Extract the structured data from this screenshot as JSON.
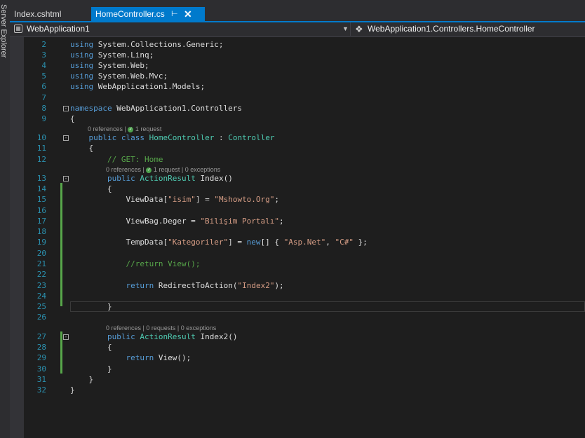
{
  "side_panel": {
    "label": "Server Explorer"
  },
  "tabs": [
    {
      "label": "Index.cshtml",
      "active": false
    },
    {
      "label": "HomeController.cs",
      "active": true
    }
  ],
  "icons": {
    "pin": "pin-icon",
    "close": "close-icon",
    "project": "csharp-project-icon",
    "class": "class-icon",
    "dropdown": "chevron-down-icon"
  },
  "navigation": {
    "project": "WebApplication1",
    "type": "WebApplication1.Controllers.HomeController"
  },
  "codelens": {
    "class": {
      "refs": "0 references",
      "requests": "1 request"
    },
    "index": {
      "refs": "0 references",
      "requests": "1 request",
      "exceptions": "0 exceptions"
    },
    "index2": {
      "refs": "0 references",
      "requests": "0 requests",
      "exceptions": "0 exceptions"
    }
  },
  "colors": {
    "accent": "#007acc",
    "keyword": "#569cd6",
    "type": "#4ec9b0",
    "string": "#d69d85",
    "comment": "#57a64a",
    "line_number": "#2b91af"
  },
  "lines": [
    {
      "n": "2",
      "segs": [
        [
          "using",
          "kw"
        ],
        [
          " System.Collections.Generic;",
          ""
        ]
      ]
    },
    {
      "n": "3",
      "segs": [
        [
          "using",
          "kw"
        ],
        [
          " System.Linq;",
          ""
        ]
      ]
    },
    {
      "n": "4",
      "segs": [
        [
          "using",
          "kw"
        ],
        [
          " System.Web;",
          ""
        ]
      ]
    },
    {
      "n": "5",
      "segs": [
        [
          "using",
          "kw"
        ],
        [
          " System.Web.Mvc;",
          ""
        ]
      ]
    },
    {
      "n": "6",
      "segs": [
        [
          "using",
          "kw"
        ],
        [
          " WebApplication1.Models;",
          ""
        ]
      ]
    },
    {
      "n": "7",
      "segs": []
    },
    {
      "n": "8",
      "segs": [
        [
          "namespace",
          "kw"
        ],
        [
          " WebApplication1.Controllers",
          ""
        ]
      ]
    },
    {
      "n": "9",
      "segs": [
        [
          "{",
          ""
        ]
      ]
    },
    {
      "n": "10",
      "segs": [
        [
          "    ",
          ""
        ],
        [
          "public",
          "kw"
        ],
        [
          " ",
          ""
        ],
        [
          "class",
          "kw"
        ],
        [
          " ",
          ""
        ],
        [
          "HomeController",
          "ty"
        ],
        [
          " : ",
          ""
        ],
        [
          "Controller",
          "ty"
        ]
      ]
    },
    {
      "n": "11",
      "segs": [
        [
          "    {",
          ""
        ]
      ]
    },
    {
      "n": "12",
      "segs": [
        [
          "        ",
          ""
        ],
        [
          "// GET: Home",
          "cm"
        ]
      ]
    },
    {
      "n": "13",
      "segs": [
        [
          "        ",
          ""
        ],
        [
          "public",
          "kw"
        ],
        [
          " ",
          ""
        ],
        [
          "ActionResult",
          "ty"
        ],
        [
          " Index()",
          ""
        ]
      ]
    },
    {
      "n": "14",
      "segs": [
        [
          "        {",
          ""
        ]
      ]
    },
    {
      "n": "15",
      "segs": [
        [
          "            ViewData[",
          ""
        ],
        [
          "\"isim\"",
          "st"
        ],
        [
          "] = ",
          ""
        ],
        [
          "\"Mshowto.Org\"",
          "st"
        ],
        [
          ";",
          ""
        ]
      ]
    },
    {
      "n": "16",
      "segs": []
    },
    {
      "n": "17",
      "segs": [
        [
          "            ViewBag.Deger = ",
          ""
        ],
        [
          "\"Bilişim Portalı\"",
          "st"
        ],
        [
          ";",
          ""
        ]
      ]
    },
    {
      "n": "18",
      "segs": []
    },
    {
      "n": "19",
      "segs": [
        [
          "            TempData[",
          ""
        ],
        [
          "\"Kategoriler\"",
          "st"
        ],
        [
          "] = ",
          ""
        ],
        [
          "new",
          "kw"
        ],
        [
          "[] { ",
          ""
        ],
        [
          "\"Asp.Net\"",
          "st"
        ],
        [
          ", ",
          ""
        ],
        [
          "\"C#\"",
          "st"
        ],
        [
          " };",
          ""
        ]
      ]
    },
    {
      "n": "20",
      "segs": []
    },
    {
      "n": "21",
      "segs": [
        [
          "            ",
          ""
        ],
        [
          "//return View();",
          "cm"
        ]
      ]
    },
    {
      "n": "22",
      "segs": []
    },
    {
      "n": "23",
      "segs": [
        [
          "            ",
          ""
        ],
        [
          "return",
          "kw"
        ],
        [
          " RedirectToAction(",
          ""
        ],
        [
          "\"Index2\"",
          "st"
        ],
        [
          ");",
          ""
        ]
      ]
    },
    {
      "n": "24",
      "segs": []
    },
    {
      "n": "25",
      "segs": [
        [
          "        }",
          ""
        ]
      ]
    },
    {
      "n": "26",
      "segs": []
    },
    {
      "n": "27",
      "segs": [
        [
          "        ",
          ""
        ],
        [
          "public",
          "kw"
        ],
        [
          " ",
          ""
        ],
        [
          "ActionResult",
          "ty"
        ],
        [
          " Index2()",
          ""
        ]
      ]
    },
    {
      "n": "28",
      "segs": [
        [
          "        {",
          ""
        ]
      ]
    },
    {
      "n": "29",
      "segs": [
        [
          "            ",
          ""
        ],
        [
          "return",
          "kw"
        ],
        [
          " View();",
          ""
        ]
      ]
    },
    {
      "n": "30",
      "segs": [
        [
          "        }",
          ""
        ]
      ]
    },
    {
      "n": "31",
      "segs": [
        [
          "    }",
          ""
        ]
      ]
    },
    {
      "n": "32",
      "segs": [
        [
          "}",
          ""
        ]
      ]
    }
  ]
}
